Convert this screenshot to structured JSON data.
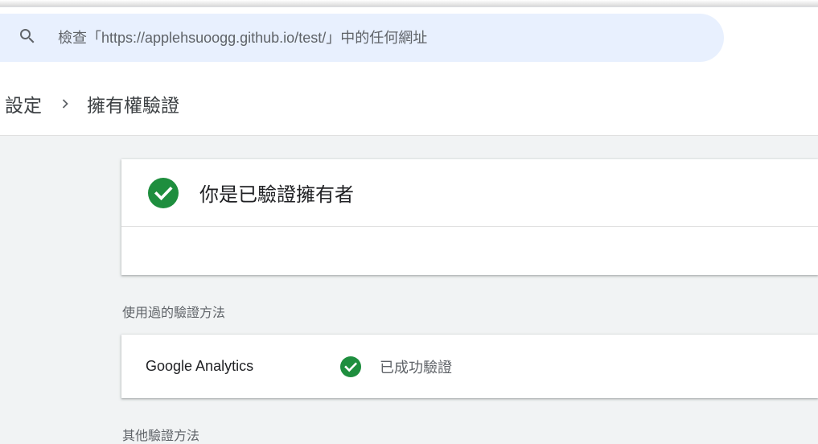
{
  "search": {
    "placeholder": "檢查「https://applehsuoogg.github.io/test/」中的任何網址",
    "icon": "search-icon"
  },
  "breadcrumb": {
    "parent": "設定",
    "current": "擁有權驗證"
  },
  "owner_card": {
    "title": "你是已驗證擁有者",
    "icon": "check-circle-icon"
  },
  "used_methods": {
    "label": "使用過的驗證方法",
    "items": [
      {
        "name": "Google Analytics",
        "status": "已成功驗證"
      }
    ]
  },
  "other_methods": {
    "label": "其他驗證方法"
  },
  "colors": {
    "success": "#1e8e3e",
    "search_bg": "#e8f0fe",
    "page_bg": "#f1f3f4"
  }
}
